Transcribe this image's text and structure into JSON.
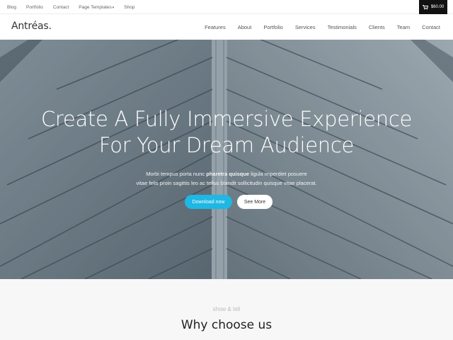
{
  "topbar": {
    "links": [
      "Blog",
      "Portfolio",
      "Contact",
      "Page Templates",
      "Shop"
    ],
    "cart_total": "$60.00"
  },
  "header": {
    "logo": "Antréas",
    "logo_dot": ".",
    "nav": [
      "Features",
      "About",
      "Portfolio",
      "Services",
      "Testimonials",
      "Clients",
      "Team",
      "Contact"
    ]
  },
  "hero": {
    "title_line1": "Create A Fully Immersive Experience",
    "title_line2": "For Your Dream Audience",
    "text_part1": "Morbi tempus porta nunc ",
    "text_bold": "pharetra quisque",
    "text_part2": " ligula imperdiet posuere",
    "text_line2": "vitae felis proin sagittis leo ac tellus blandit sollicitudin quisque vitae placerat.",
    "primary_button": "Download now",
    "secondary_button": "See More"
  },
  "section": {
    "eyebrow": "show & tell",
    "title": "Why choose us"
  },
  "colors": {
    "accent": "#1fb7e3",
    "cart_bg": "#111111",
    "section_bg": "#f7f7f7"
  }
}
